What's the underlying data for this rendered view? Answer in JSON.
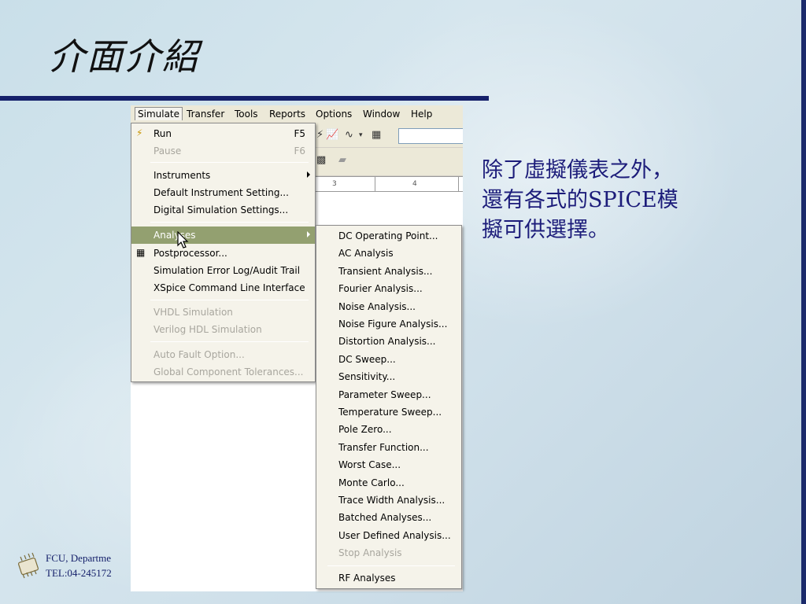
{
  "slide": {
    "title": "介面介紹",
    "body_lines": [
      "除了虛擬儀表之外，",
      "還有各式的SPICE模",
      "擬可供選擇。"
    ],
    "footer_line1": "FCU, Departme",
    "footer_line2": "TEL:04-245172"
  },
  "menubar": {
    "items": [
      {
        "label": "Simulate",
        "accel": "S"
      },
      {
        "label": "Transfer",
        "accel": "r"
      },
      {
        "label": "Tools",
        "accel": "T"
      },
      {
        "label": "Reports",
        "accel": "R"
      },
      {
        "label": "Options",
        "accel": "O"
      },
      {
        "label": "Window",
        "accel": "W"
      },
      {
        "label": "Help",
        "accel": "H"
      }
    ]
  },
  "ruler": {
    "labels": [
      "3",
      "4"
    ]
  },
  "simulate_menu": {
    "items": [
      {
        "label": "Run",
        "shortcut": "F5",
        "enabled": true,
        "icon": "lightning-icon"
      },
      {
        "label": "Pause",
        "shortcut": "F6",
        "enabled": false
      },
      {
        "label": "Instruments",
        "enabled": true,
        "submenu": true
      },
      {
        "label": "Default Instrument Setting...",
        "enabled": true
      },
      {
        "label": "Digital Simulation Settings...",
        "enabled": true
      },
      {
        "label": "Analyses",
        "enabled": true,
        "submenu": true,
        "highlighted": true
      },
      {
        "label": "Postprocessor...",
        "enabled": true,
        "icon": "calculator-icon"
      },
      {
        "label": "Simulation Error Log/Audit Trail",
        "enabled": true
      },
      {
        "label": "XSpice Command Line Interface",
        "enabled": true
      },
      {
        "label": "VHDL Simulation",
        "enabled": false
      },
      {
        "label": "Verilog HDL Simulation",
        "enabled": false
      },
      {
        "label": "Auto Fault Option...",
        "enabled": false
      },
      {
        "label": "Global Component Tolerances...",
        "enabled": false
      }
    ]
  },
  "analyses_menu": {
    "items": [
      {
        "label": "DC Operating Point...",
        "enabled": true
      },
      {
        "label": "AC Analysis",
        "enabled": true
      },
      {
        "label": "Transient Analysis...",
        "enabled": true
      },
      {
        "label": "Fourier Analysis...",
        "enabled": true
      },
      {
        "label": "Noise Analysis...",
        "enabled": true
      },
      {
        "label": "Noise Figure Analysis...",
        "enabled": true
      },
      {
        "label": "Distortion Analysis...",
        "enabled": true
      },
      {
        "label": "DC Sweep...",
        "enabled": true
      },
      {
        "label": "Sensitivity...",
        "enabled": true
      },
      {
        "label": "Parameter Sweep...",
        "enabled": true
      },
      {
        "label": "Temperature Sweep...",
        "enabled": true
      },
      {
        "label": "Pole Zero...",
        "enabled": true
      },
      {
        "label": "Transfer Function...",
        "enabled": true
      },
      {
        "label": "Worst Case...",
        "enabled": true
      },
      {
        "label": "Monte Carlo...",
        "enabled": true
      },
      {
        "label": "Trace Width Analysis...",
        "enabled": true
      },
      {
        "label": "Batched Analyses...",
        "enabled": true
      },
      {
        "label": "User Defined Analysis...",
        "enabled": true
      },
      {
        "label": "Stop Analysis",
        "enabled": false
      },
      {
        "label": "RF Analyses",
        "enabled": true
      }
    ]
  },
  "colors": {
    "title_rule": "#15206a",
    "body_text": "#1c1c7a",
    "menu_highlight": "#93a070",
    "menu_background": "#f5f3ea"
  }
}
